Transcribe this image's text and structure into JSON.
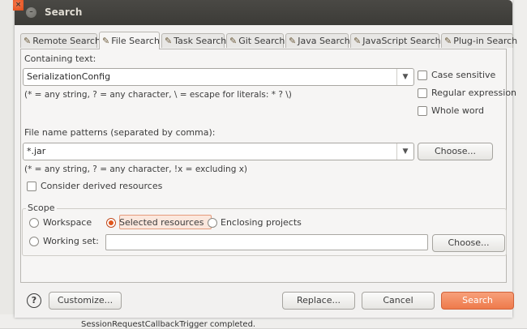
{
  "window": {
    "title": "Search"
  },
  "background": {
    "status_text": "SessionRequestCallbackTrigger completed."
  },
  "tabs": [
    {
      "label": "Remote Search",
      "icon": "flashlight-icon",
      "active": false
    },
    {
      "label": "File Search",
      "icon": "file-search-icon",
      "active": true
    },
    {
      "label": "Task Search",
      "icon": "task-search-icon",
      "active": false
    },
    {
      "label": "Git Search",
      "icon": "git-search-icon",
      "active": false
    },
    {
      "label": "Java Search",
      "icon": "java-search-icon",
      "active": false
    },
    {
      "label": "JavaScript Search",
      "icon": "javascript-search-icon",
      "active": false
    },
    {
      "label": "Plug-in Search",
      "icon": "plugin-search-icon",
      "active": false
    }
  ],
  "containing_text": {
    "label": "Containing text:",
    "value": "SerializationConfig",
    "hint": "(* = any string, ? = any character, \\ = escape for literals: * ? \\)"
  },
  "options": {
    "case_sensitive": "Case sensitive",
    "regular_expression": "Regular expression",
    "whole_word": "Whole word"
  },
  "file_patterns": {
    "label": "File name patterns (separated by comma):",
    "value": "*.jar",
    "choose": "Choose...",
    "hint": "(* = any string, ? = any character, !x = excluding x)",
    "derived": "Consider derived resources"
  },
  "scope": {
    "title": "Scope",
    "workspace": "Workspace",
    "selected": "Selected resources",
    "enclosing": "Enclosing projects",
    "working_set": "Working set:",
    "working_set_value": "",
    "choose": "Choose..."
  },
  "buttons": {
    "customize": "Customize...",
    "replace": "Replace...",
    "cancel": "Cancel",
    "search": "Search"
  },
  "colors": {
    "accent": "#ee7a4b",
    "titlebar": "#3c3b37"
  }
}
